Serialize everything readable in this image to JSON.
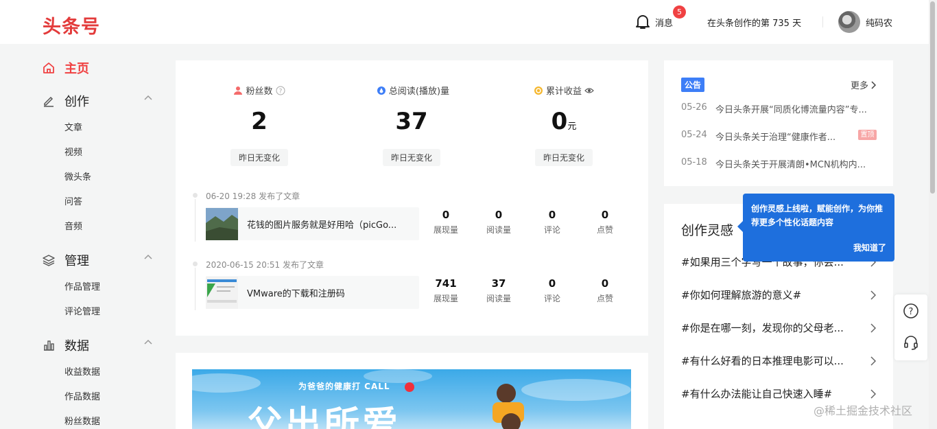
{
  "header": {
    "logo": "头条号",
    "messages_label": "消息",
    "messages_badge": "5",
    "days_text": "在头条创作的第 735 天",
    "username": "纯码农"
  },
  "sidebar": {
    "home": "主页",
    "groups": [
      {
        "title": "创作",
        "items": [
          "文章",
          "视频",
          "微头条",
          "问答",
          "音频"
        ]
      },
      {
        "title": "管理",
        "items": [
          "作品管理",
          "评论管理"
        ]
      },
      {
        "title": "数据",
        "items": [
          "收益数据",
          "作品数据",
          "粉丝数据"
        ]
      }
    ]
  },
  "stats": [
    {
      "label": "粉丝数",
      "value": "2",
      "unit": "",
      "change": "昨日无变化"
    },
    {
      "label": "总阅读(播放)量",
      "value": "37",
      "unit": "",
      "change": "昨日无变化"
    },
    {
      "label": "累计收益",
      "value": "0",
      "unit": "元",
      "change": "昨日无变化"
    }
  ],
  "timeline": [
    {
      "meta": "06-20 19:28  发布了文章",
      "title": "花钱的图片服务就是好用哈（picGo...",
      "metrics": [
        {
          "value": "0",
          "label": "展现量"
        },
        {
          "value": "0",
          "label": "阅读量"
        },
        {
          "value": "0",
          "label": "评论"
        },
        {
          "value": "0",
          "label": "点赞"
        }
      ]
    },
    {
      "meta": "2020-06-15 20:51  发布了文章",
      "title": "VMware的下载和注册码",
      "metrics": [
        {
          "value": "741",
          "label": "展现量"
        },
        {
          "value": "37",
          "label": "阅读量"
        },
        {
          "value": "0",
          "label": "评论"
        },
        {
          "value": "0",
          "label": "点赞"
        }
      ]
    }
  ],
  "banner": {
    "tag": "为爸爸的健康打 CALL",
    "headline": "父出所爱"
  },
  "notice": {
    "tag": "公告",
    "more": "更多",
    "items": [
      {
        "date": "05-26",
        "text": "今日头条开展“同质化博流量内容”专..."
      },
      {
        "date": "05-24",
        "text": "今日头条关于治理“健康作者...",
        "hot": "置顶"
      },
      {
        "date": "05-18",
        "text": "今日头条关于开展清朗•MCN机构内..."
      }
    ]
  },
  "inspire": {
    "title": "创作灵感",
    "topics": [
      "#如果用三个字写一个故事，你会...",
      "#你如何理解旅游的意义#",
      "#你是在哪一刻，发现你的父母老...",
      "#有什么好看的日本推理电影可以...",
      "#有什么办法能让自己快速入睡#"
    ]
  },
  "popup": {
    "text": "创作灵感上线啦，赋能创作，为你推荐更多个性化话题内容",
    "button": "我知道了"
  },
  "watermark": "@稀土掘金技术社区"
}
